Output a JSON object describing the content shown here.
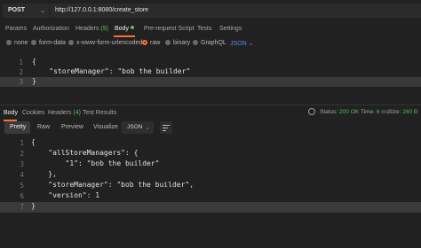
{
  "request": {
    "method": "POST",
    "url": "http://127.0.0.1:8080/create_store"
  },
  "request_tabs": [
    {
      "label": "Params"
    },
    {
      "label": "Authorization"
    },
    {
      "label": "Headers",
      "count": "(9)"
    },
    {
      "label": "Body"
    },
    {
      "label": "Pre-request Script"
    },
    {
      "label": "Tests"
    },
    {
      "label": "Settings"
    }
  ],
  "body_options": {
    "none": "none",
    "form_data": "form-data",
    "urlencoded": "x-www-form-urlencoded",
    "raw": "raw",
    "binary": "binary",
    "graphql": "GraphQL",
    "format": "JSON",
    "selected": "raw"
  },
  "request_body_lines": [
    {
      "num": "1",
      "text": "{"
    },
    {
      "num": "2",
      "text": "    \"storeManager\": \"bob the builder\""
    },
    {
      "num": "3",
      "text": "}"
    }
  ],
  "response_tabs": [
    {
      "label": "Body"
    },
    {
      "label": "Cookies"
    },
    {
      "label": "Headers",
      "count": "(4)"
    },
    {
      "label": "Test Results"
    }
  ],
  "response_status": {
    "status_label": "Status:",
    "status_value": "200 OK",
    "time_label": "Time:",
    "time_value": "6 ms",
    "size_label": "Size:",
    "size_value": "260 B"
  },
  "response_view": {
    "pretty": "Pretty",
    "raw": "Raw",
    "preview": "Preview",
    "visualize": "Visualize",
    "format": "JSON"
  },
  "response_body_lines": [
    {
      "num": "1",
      "text": "{"
    },
    {
      "num": "2",
      "text": "    \"allStoreManagers\": {"
    },
    {
      "num": "3",
      "text": "        \"1\": \"bob the builder\""
    },
    {
      "num": "4",
      "text": "    },"
    },
    {
      "num": "5",
      "text": "    \"storeManager\": \"bob the builder\","
    },
    {
      "num": "6",
      "text": "    \"version\": 1"
    },
    {
      "num": "7",
      "text": "}"
    }
  ],
  "colors": {
    "accent": "#ff6c37",
    "success": "#5cba5c",
    "link": "#4f8fe8",
    "background": "#212121"
  }
}
